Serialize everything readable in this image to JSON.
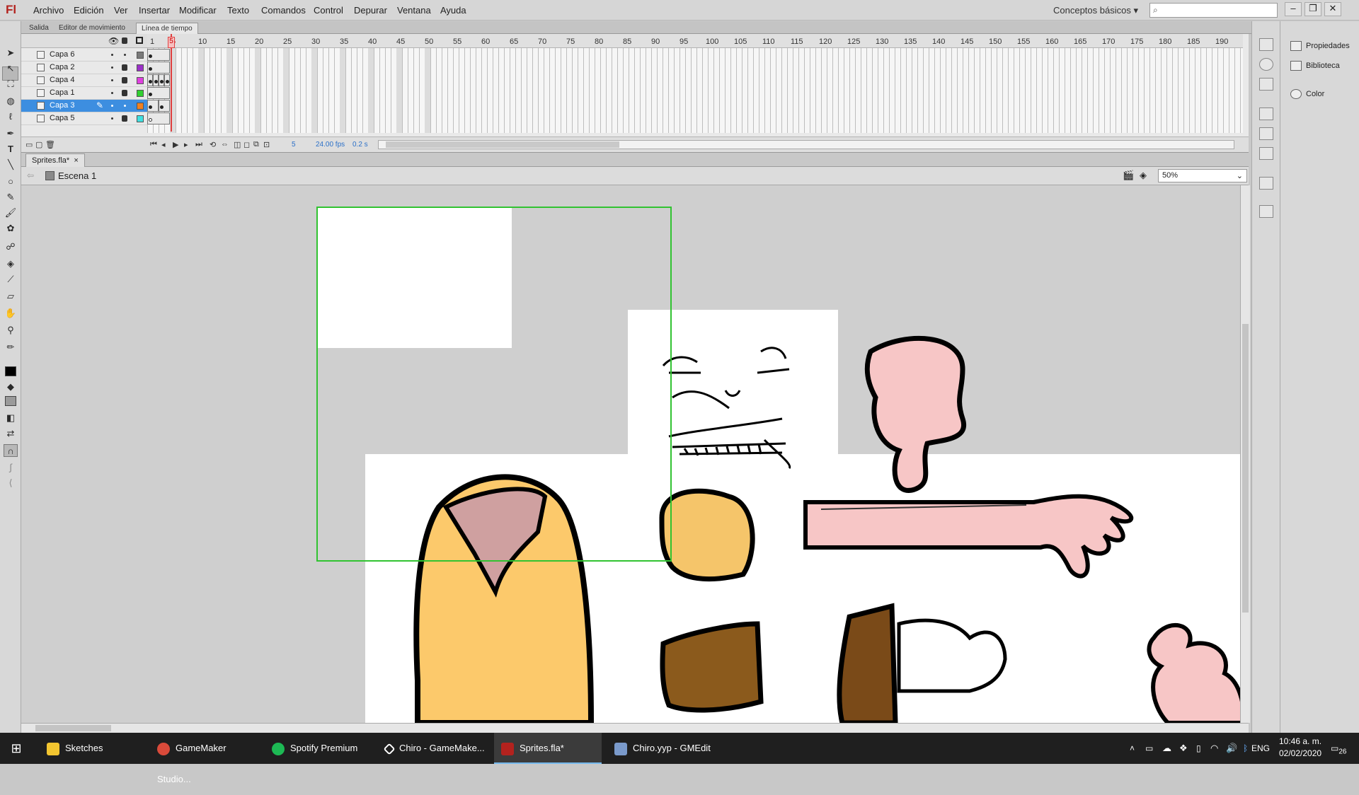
{
  "app": {
    "logo": "Fl"
  },
  "menu": {
    "items": [
      "Archivo",
      "Edición",
      "Ver",
      "Insertar",
      "Modificar",
      "Texto",
      "Comandos",
      "Control",
      "Depurar",
      "Ventana",
      "Ayuda"
    ],
    "workspace": "Conceptos básicos",
    "search_icon": "⌕"
  },
  "window_buttons": {
    "minimize": "–",
    "restore": "❐",
    "close": "✕"
  },
  "panel_tabs": [
    "Salida",
    "Editor de movimiento",
    "Línea de tiempo"
  ],
  "timeline": {
    "frame_numbers": [
      "1",
      "5",
      "10",
      "15",
      "20",
      "25",
      "30",
      "35",
      "40",
      "45",
      "50",
      "55",
      "60",
      "65",
      "70",
      "75",
      "80",
      "85",
      "90",
      "95",
      "100",
      "105",
      "110",
      "115",
      "120",
      "125",
      "130",
      "135",
      "140",
      "145",
      "150",
      "155",
      "160",
      "165",
      "170",
      "175",
      "180",
      "185",
      "190"
    ],
    "current_frame": "5",
    "fps": "24.00 fps",
    "time": "0.2 s",
    "layers": [
      {
        "name": "Capa 6",
        "color": "#7a7a7a",
        "selected": false
      },
      {
        "name": "Capa 2",
        "color": "#9b30c8",
        "selected": false
      },
      {
        "name": "Capa 4",
        "color": "#e040e0",
        "selected": false
      },
      {
        "name": "Capa 1",
        "color": "#30d030",
        "selected": false
      },
      {
        "name": "Capa 3",
        "color": "#f08020",
        "selected": true
      },
      {
        "name": "Capa 5",
        "color": "#40e0e0",
        "selected": false
      }
    ]
  },
  "right_panel": {
    "items": [
      "Propiedades",
      "Biblioteca",
      "Color"
    ]
  },
  "document": {
    "tab": "Sprites.fla*",
    "close": "×",
    "scene": "Escena 1",
    "zoom": "50%"
  },
  "taskbar": {
    "items": [
      {
        "label": "Sketches",
        "color": "#f2c530"
      },
      {
        "label": "GameMaker Studio...",
        "color": "#d94a3a"
      },
      {
        "label": "Spotify Premium",
        "color": "#1db954"
      },
      {
        "label": "Chiro - GameMake...",
        "color": "#ffffff"
      },
      {
        "label": "Sprites.fla*",
        "color": "#b3221e"
      },
      {
        "label": "Chiro.yyp - GMEdit",
        "color": "#7a9acb"
      }
    ],
    "language": "ENG",
    "time": "10:46 a. m.",
    "date": "02/02/2020",
    "notifications": "26"
  }
}
